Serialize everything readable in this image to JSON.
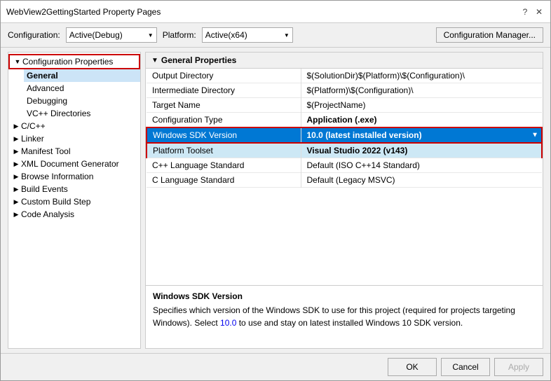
{
  "dialog": {
    "title": "WebView2GettingStarted Property Pages",
    "title_icons": [
      "?",
      "✕"
    ]
  },
  "config_bar": {
    "configuration_label": "Configuration:",
    "configuration_value": "Active(Debug)",
    "platform_label": "Platform:",
    "platform_value": "Active(x64)",
    "manager_button": "Configuration Manager..."
  },
  "left_panel": {
    "tree": {
      "root_label": "Configuration Properties",
      "children": [
        {
          "label": "General",
          "active": true
        },
        {
          "label": "Advanced"
        },
        {
          "label": "Debugging"
        },
        {
          "label": "VC++ Directories"
        }
      ],
      "expandable_items": [
        {
          "label": "C/C++",
          "expanded": false
        },
        {
          "label": "Linker",
          "expanded": false
        },
        {
          "label": "Manifest Tool",
          "expanded": false
        },
        {
          "label": "XML Document Generator",
          "expanded": false
        },
        {
          "label": "Browse Information",
          "expanded": false
        },
        {
          "label": "Build Events",
          "expanded": false
        },
        {
          "label": "Custom Build Step",
          "expanded": false
        },
        {
          "label": "Code Analysis",
          "expanded": false
        }
      ]
    }
  },
  "right_panel": {
    "section_header": "General Properties",
    "properties": [
      {
        "name": "Output Directory",
        "value": "$(SolutionDir)$(Platform)\\$(Configuration)\\",
        "bold": false,
        "selected": false
      },
      {
        "name": "Intermediate Directory",
        "value": "$(Platform)\\$(Configuration)\\",
        "bold": false,
        "selected": false
      },
      {
        "name": "Target Name",
        "value": "$(ProjectName)",
        "bold": false,
        "selected": false
      },
      {
        "name": "Configuration Type",
        "value": "Application (.exe)",
        "bold": true,
        "selected": false
      },
      {
        "name": "Windows SDK Version",
        "value": "10.0 (latest installed version)",
        "bold": true,
        "selected": true,
        "has_dropdown": true
      },
      {
        "name": "Platform Toolset",
        "value": "Visual Studio 2022 (v143)",
        "bold": true,
        "selected": false,
        "secondary_selected": true
      },
      {
        "name": "C++ Language Standard",
        "value": "Default (ISO C++14 Standard)",
        "bold": false,
        "selected": false
      },
      {
        "name": "C Language Standard",
        "value": "Default (Legacy MSVC)",
        "bold": false,
        "selected": false
      }
    ],
    "description": {
      "title": "Windows SDK Version",
      "text_parts": [
        "Specifies which version of the Windows SDK to use for this project (required for projects targeting Windows). Select ",
        "10.0",
        " to use and stay on latest installed Windows 10 SDK version."
      ]
    }
  },
  "footer": {
    "ok_label": "OK",
    "cancel_label": "Cancel",
    "apply_label": "Apply"
  }
}
